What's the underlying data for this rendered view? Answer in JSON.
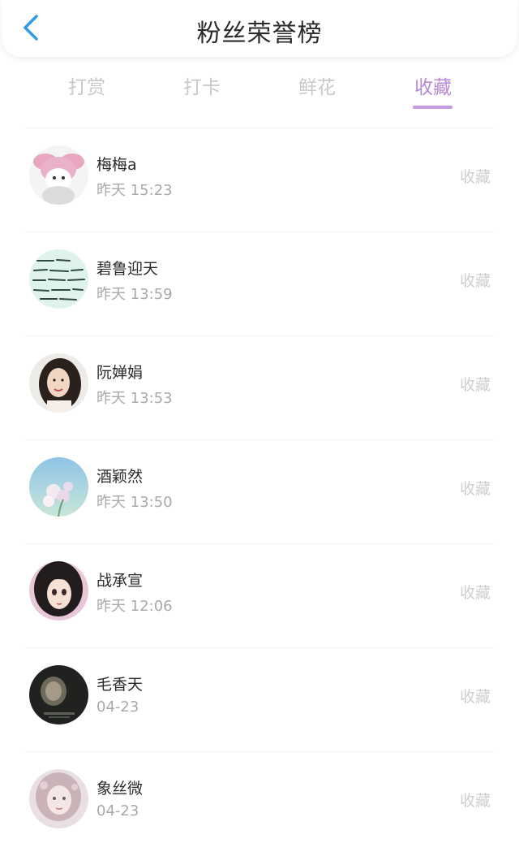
{
  "header": {
    "title": "粉丝荣誉榜"
  },
  "colors": {
    "accent": "#b789d3",
    "back_arrow": "#2f9be6",
    "muted_text": "#c8c8c8"
  },
  "tabs": [
    {
      "label": "打赏",
      "active": false
    },
    {
      "label": "打卡",
      "active": false
    },
    {
      "label": "鲜花",
      "active": false
    },
    {
      "label": "收藏",
      "active": true
    }
  ],
  "fans": [
    {
      "name": "梅梅a",
      "time": "昨天 15:23",
      "action": "收藏",
      "avatar": "pink-bunny-avatar"
    },
    {
      "name": "碧鲁迎天",
      "time": "昨天 13:59",
      "action": "收藏",
      "avatar": "handwritten-text-avatar"
    },
    {
      "name": "阮婵娟",
      "time": "昨天 13:53",
      "action": "收藏",
      "avatar": "woman-portrait-avatar"
    },
    {
      "name": "酒颖然",
      "time": "昨天 13:50",
      "action": "收藏",
      "avatar": "flowers-sky-avatar"
    },
    {
      "name": "战承宣",
      "time": "昨天 12:06",
      "action": "收藏",
      "avatar": "anime-girl-avatar"
    },
    {
      "name": "毛香天",
      "time": "04-23",
      "action": "收藏",
      "avatar": "dark-portrait-avatar"
    },
    {
      "name": "象丝微",
      "time": "04-23",
      "action": "收藏",
      "avatar": "illustrated-girl-avatar"
    }
  ]
}
